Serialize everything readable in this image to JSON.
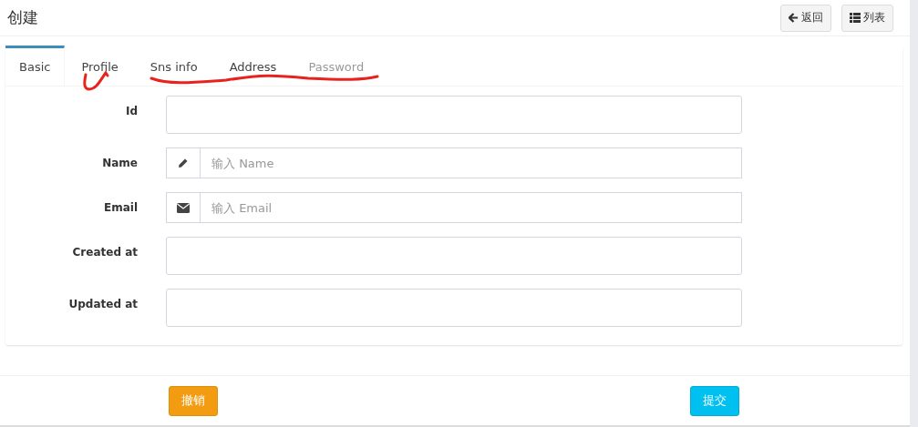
{
  "header": {
    "title": "创建",
    "buttons": [
      {
        "kind": "back",
        "label": "返回"
      },
      {
        "kind": "list",
        "label": "列表"
      }
    ]
  },
  "tabs": [
    {
      "label": "Basic",
      "selected": true,
      "disabled": false
    },
    {
      "label": "Profile",
      "selected": false,
      "disabled": false
    },
    {
      "label": "Sns info",
      "selected": false,
      "disabled": false
    },
    {
      "label": "Address",
      "selected": false,
      "disabled": false
    },
    {
      "label": "Password",
      "selected": false,
      "disabled": true
    }
  ],
  "fields": [
    {
      "label": "Id",
      "kind": "plain"
    },
    {
      "label": "Name",
      "kind": "pencil",
      "placeholder": "输入 Name"
    },
    {
      "label": "Email",
      "kind": "envelope",
      "placeholder": "输入 Email"
    },
    {
      "label": "Created at",
      "kind": "plain"
    },
    {
      "label": "Updated at",
      "kind": "plain"
    }
  ],
  "footer": {
    "buttons": [
      {
        "kind": "warning",
        "label": "撤销"
      },
      {
        "kind": "info",
        "label": "提交"
      }
    ]
  }
}
